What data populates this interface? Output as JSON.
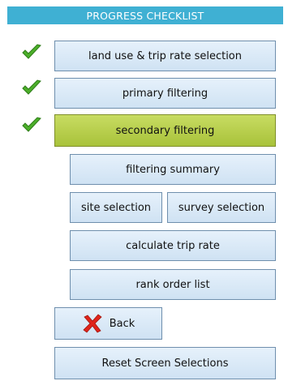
{
  "header": {
    "title": "PROGRESS CHECKLIST"
  },
  "steps": [
    {
      "label": "land use & trip rate selection",
      "completed": true
    },
    {
      "label": "primary filtering",
      "completed": true
    },
    {
      "label": "secondary filtering",
      "completed": true,
      "active": true
    },
    {
      "label": "filtering summary"
    },
    {
      "label": "site selection"
    },
    {
      "label": "survey selection"
    },
    {
      "label": "calculate trip rate"
    },
    {
      "label": "rank order list"
    }
  ],
  "back": {
    "label": "Back",
    "icon": "close-icon"
  },
  "reset": {
    "label": "Reset Screen Selections"
  },
  "colors": {
    "header_bg": "#3fb0d3",
    "button_bg": "#d9e8f6",
    "active_bg": "#b5cf49",
    "check": "#4caf2a",
    "back_x": "#e0241b"
  }
}
